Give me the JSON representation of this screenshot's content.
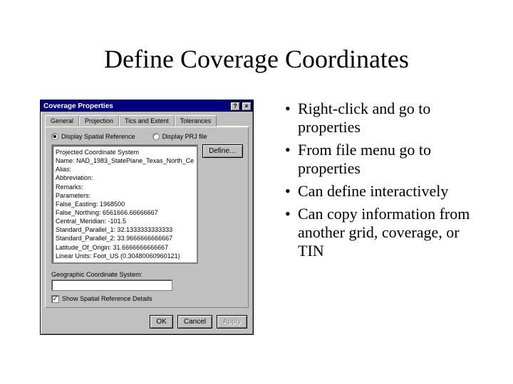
{
  "slide": {
    "title": "Define Coverage Coordinates",
    "bullets": [
      "Right-click and go to properties",
      "From file menu go to properties",
      "Can define interactively",
      "Can copy information from another grid, coverage, or TIN"
    ]
  },
  "dialog": {
    "title": "Coverage Properties",
    "helpGlyph": "?",
    "closeGlyph": "×",
    "tabs": {
      "general": "General",
      "projection": "Projection",
      "ticsExtent": "Tics and Extent",
      "tolerances": "Tolerances"
    },
    "radios": {
      "displaySpatialRef": "Display Spatial Reference",
      "displayPrjFile": "Display PRJ file"
    },
    "defineBtn": "Define…",
    "projInfo": {
      "line1": "Projected Coordinate System",
      "line2": "Name:   NAD_1983_StatePlane_Texas_North_Ce",
      "line3": "Alias:",
      "line4": "Abbreviation:",
      "line5": "Remarks:",
      "line6": "Parameters:",
      "line7": " False_Easting:  1968500",
      "line8": " False_Northing:  6561666.66666667",
      "line9": " Central_Meridian:   -101.5",
      "line10": " Standard_Parallel_1:  32.1333333333333",
      "line11": " Standard_Parallel_2:  33.9666666666667",
      "line12": " Latitude_Of_Origin:  31.6666666666667",
      "line13": " Linear Units:  Foot_US (0.30480060960121)"
    },
    "geoLabel": "Geographic Coordinate System:",
    "checkbox": {
      "label": "Show Spatial Reference Details",
      "checkGlyph": "✓"
    },
    "buttons": {
      "ok": "OK",
      "cancel": "Cancel",
      "apply": "Apply"
    }
  }
}
